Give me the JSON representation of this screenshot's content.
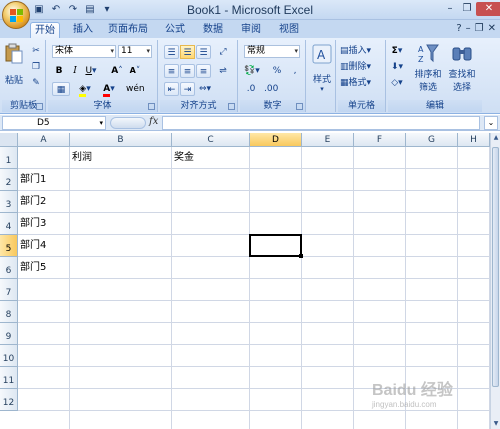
{
  "window": {
    "title": "Book1 - Microsoft Excel"
  },
  "quick_access": [
    "save-icon",
    "undo-icon",
    "redo-icon",
    "print-preview-icon",
    "customize-icon"
  ],
  "tabs": [
    {
      "label": "开始",
      "active": true
    },
    {
      "label": "插入"
    },
    {
      "label": "页面布局"
    },
    {
      "label": "公式"
    },
    {
      "label": "数据"
    },
    {
      "label": "审阅"
    },
    {
      "label": "视图"
    }
  ],
  "ribbon": {
    "clipboard": {
      "paste_label": "粘贴",
      "group_label": "剪贴板"
    },
    "font": {
      "name": "宋体",
      "size": "11",
      "group_label": "字体"
    },
    "alignment": {
      "group_label": "对齐方式"
    },
    "number": {
      "format": "常规",
      "group_label": "数字",
      "percent": "%"
    },
    "styles": {
      "label": "样式"
    },
    "cells": {
      "insert": "插入",
      "delete": "删除",
      "format": "格式",
      "group_label": "单元格"
    },
    "editing": {
      "sort_filter_line1": "排序和",
      "sort_filter_line2": "筛选",
      "find_select_line1": "查找和",
      "find_select_line2": "选择",
      "group_label": "编辑"
    }
  },
  "formula_bar": {
    "name_box": "D5",
    "fx": "fx",
    "formula": ""
  },
  "sheet": {
    "columns": [
      "A",
      "B",
      "C",
      "D",
      "E",
      "F",
      "G",
      "H"
    ],
    "rows": [
      "1",
      "2",
      "3",
      "4",
      "5",
      "6",
      "7",
      "8",
      "9",
      "10",
      "11",
      "12"
    ],
    "cells": {
      "B1": "利润",
      "C1": "奖金",
      "A2": "部门1",
      "A3": "部门2",
      "A4": "部门3",
      "A5": "部门4",
      "A6": "部门5"
    },
    "active_cell": "D5"
  },
  "watermark": {
    "text": "Baidu 经验",
    "sub": "jingyan.baidu.com"
  },
  "colors": {
    "accent": "#15428b",
    "tab_bg": "#c4d8f1",
    "selected_header": "#f8c85d"
  }
}
